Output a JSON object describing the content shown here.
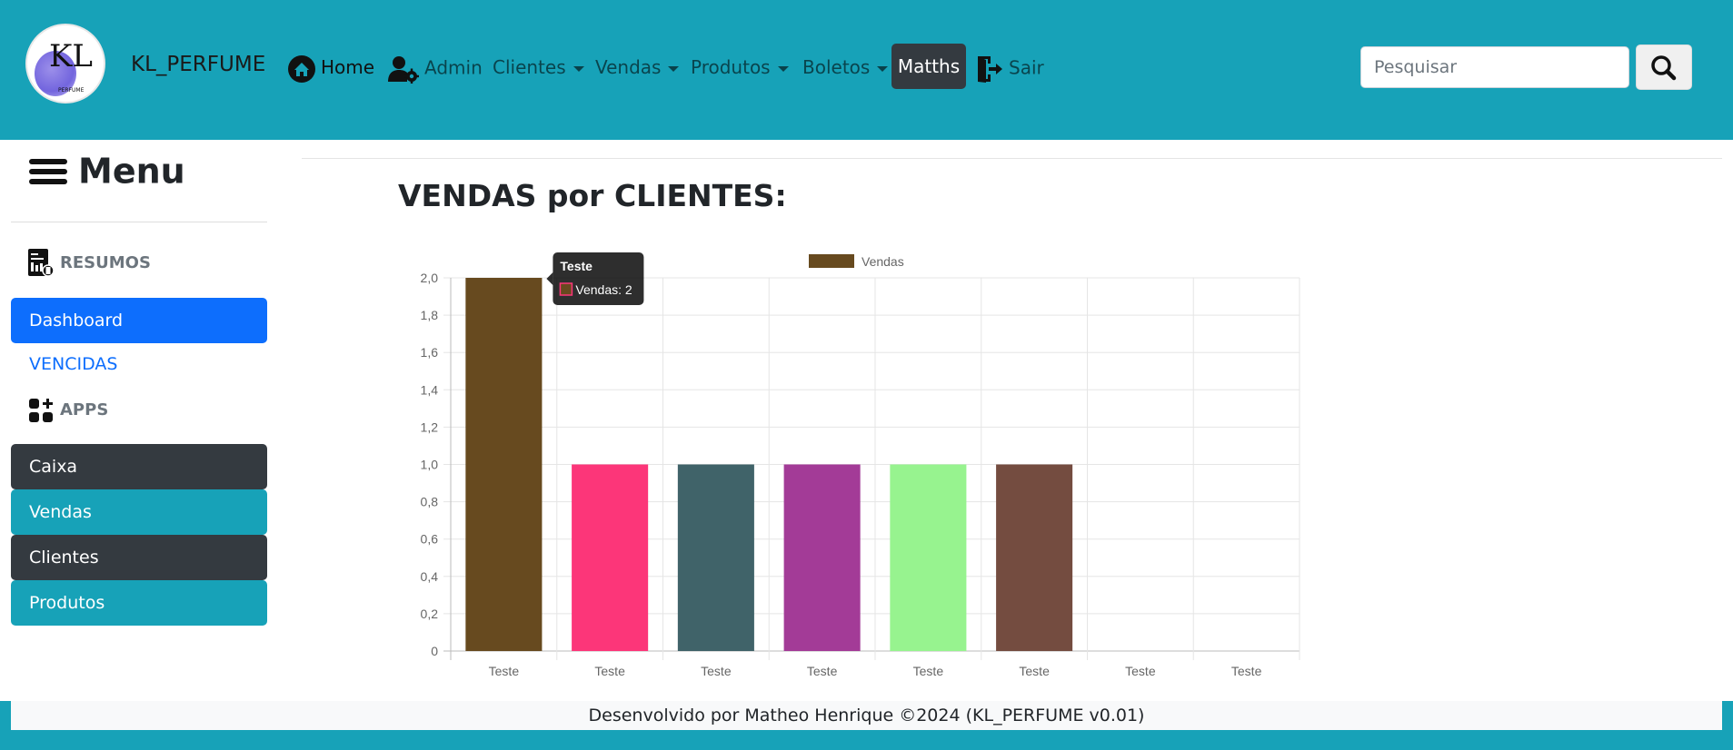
{
  "navbar": {
    "brand": "KL_PERFUME",
    "logo_text": "KL",
    "logo_subtext": "PERFUME",
    "items": {
      "home": "Home",
      "admin": "Admin",
      "clientes": "Clientes",
      "vendas": "Vendas",
      "produtos": "Produtos",
      "boletos": "Boletos",
      "matths": "Matths",
      "sair": "Sair"
    },
    "search_placeholder": "Pesquisar"
  },
  "sidebar": {
    "title": "Menu",
    "resumos": "RESUMOS",
    "dashboard": "Dashboard",
    "vencidas": "VENCIDAS",
    "apps": "APPS",
    "caixa": "Caixa",
    "vendas": "Vendas",
    "clientes": "Clientes",
    "produtos": "Produtos"
  },
  "main": {
    "title": "VENDAS por CLIENTES:"
  },
  "chart_data": {
    "type": "bar",
    "categories": [
      "Teste",
      "Teste",
      "Teste",
      "Teste",
      "Teste",
      "Teste",
      "Teste",
      "Teste"
    ],
    "series": [
      {
        "name": "Vendas",
        "values": [
          2,
          1,
          1,
          1,
          1,
          1,
          0,
          0
        ]
      }
    ],
    "bar_colors": [
      "#674a1f",
      "#fc3679",
      "#406369",
      "#a33b97",
      "#97f38f",
      "#744c40",
      "#cccccc",
      "#cccccc"
    ],
    "ylim": [
      0,
      2
    ],
    "yticks": [
      "0",
      "0,2",
      "0,4",
      "0,6",
      "0,8",
      "1,0",
      "1,2",
      "1,4",
      "1,6",
      "1,8",
      "2,0"
    ],
    "legend_position": "top",
    "grid": true,
    "tooltip": {
      "title": "Teste",
      "label": "Vendas: 2",
      "category_index": 0
    }
  },
  "footer": {
    "text": "Desenvolvido por Matheo Henrique ©2024 (KL_PERFUME v0.01)"
  },
  "colors": {
    "navbar": "#17a2b8",
    "primary": "#0d6efd",
    "dark": "#343a40",
    "info": "#17a2b8"
  }
}
